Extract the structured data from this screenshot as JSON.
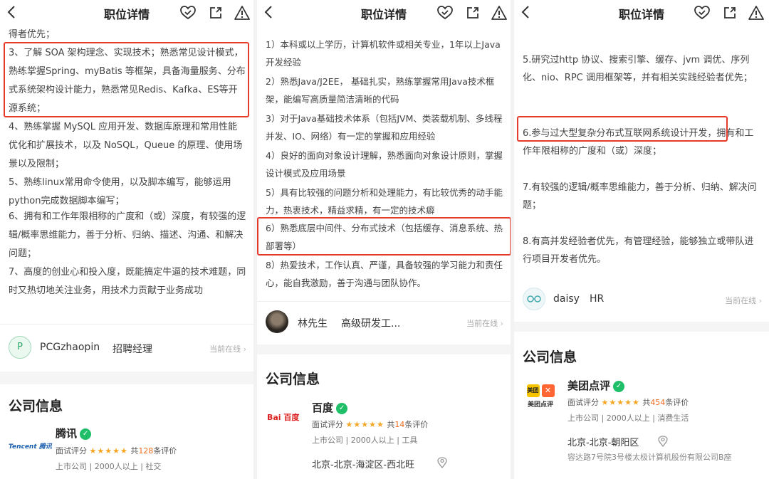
{
  "colors": {
    "highlight_box": "#e53b2c",
    "verified": "#1fbf6a",
    "star": "#f6a623",
    "accent_count": "#f26b1d"
  },
  "icons": [
    "back-icon",
    "heart-check-icon",
    "share-icon",
    "report-icon",
    "location-pin-icon",
    "chevron-right-icon"
  ],
  "panel1": {
    "title": "职位详情",
    "paragraphs": [
      "得者优先；",
      "3、了解 SOA 架构理念、实现技术；熟悉常见设计模式，熟练掌握Spring、myBatis 等框架，具备海量服务、分布式系统架构设计能力，熟悉常见Redis、Kafka、ES等开源系统；",
      "4、熟练掌握 MySQL 应用开发、数据库原理和常用性能优化和扩展技术，以及 NoSQL，Queue 的原理、使用场景以及限制；",
      "5、熟练linux常用命令使用，以及脚本编写，能够运用python完成数据脚本编写；",
      "6、拥有和工作年限相称的广度和（或）深度，有较强的逻辑/概率思维能力，善于分析、归纳、描述、沟通、和解决问题；",
      "7、高度的创业心和投入度，既能搞定牛逼的技术难题，同时又热切地关注业务，用技术力贡献于业务成功"
    ],
    "recruiter": {
      "avatar_letter": "P",
      "name": "PCGzhaopin",
      "title": "招聘经理",
      "status": "当前在线"
    },
    "company_section": "公司信息",
    "company": {
      "logo_text": "Tencent 腾讯",
      "name": "腾讯",
      "rating_label": "面试评分",
      "stars": "★★★★★",
      "count_prefix": "共",
      "count": "128",
      "count_suffix": "条评价",
      "meta": "上市公司 | 2000人以上 | 社交"
    }
  },
  "panel2": {
    "title": "职位详情",
    "paragraphs": [
      "1）本科或以上学历，计算机软件或相关专业，1年以上Java开发经验",
      "2）熟悉Java/J2EE， 基础扎实，熟练掌握常用Java技术框架，能编写高质量简洁清晰的代码",
      "3）对于Java基础技术体系（包括JVM、类装载机制、多线程并发、IO、网络）有一定的掌握和应用经验",
      "4）良好的面向对象设计理解，熟悉面向对象设计原则，掌握设计模式及应用场景",
      "5）具有比较强的问题分析和处理能力，有比较优秀的动手能力，热衷技术，精益求精，有一定的技术癖",
      "6）熟悉底层中间件、分布式技术（包括缓存、消息系统、热部署等）",
      "8）热爱技术，工作认真、严谨，具备较强的学习能力和责任心，能自我激励，善于沟通与团队协作。"
    ],
    "recruiter": {
      "name": "林先生",
      "title": "高级研发工...",
      "status": "当前在线"
    },
    "company_section": "公司信息",
    "company": {
      "logo_text": "Bai 百度",
      "name": "百度",
      "rating_label": "面试评分",
      "stars": "★★★★★",
      "count_prefix": "共",
      "count": "14",
      "count_suffix": "条评价",
      "meta": "上市公司 | 2000人以上 | 工具",
      "address": "北京-北京-海淀区-西北旺"
    }
  },
  "panel3": {
    "title": "职位详情",
    "paragraphs": [
      "5.研究过http 协议、搜索引擎、缓存、jvm 调优、序列化、nio、RPC 调用框架等，并有相关实践经验者优先；",
      "6.参与过大型复杂分布式互联网系统设计开发，拥有和工作年限相称的广度和（或）深度；",
      "7.有较强的逻辑/概率思维能力，善于分析、归纳、解决问题；",
      "8.有高并发经验者优先，有管理经验，能够独立或带队进行项目开发者优先。"
    ],
    "recruiter": {
      "name": "daisy",
      "title": "HR",
      "status": "当前在线"
    },
    "company_section": "公司信息",
    "company": {
      "logo_text": "美团点评",
      "name": "美团点评",
      "rating_label": "面试评分",
      "stars": "★★★★★",
      "count_prefix": "共",
      "count": "454",
      "count_suffix": "条评价",
      "meta": "上市公司 | 2000人以上 | 消费生活",
      "address": "北京-北京-朝阳区",
      "address_detail": "容达路7号院3号楼太极计算机股份有限公司B座"
    }
  }
}
